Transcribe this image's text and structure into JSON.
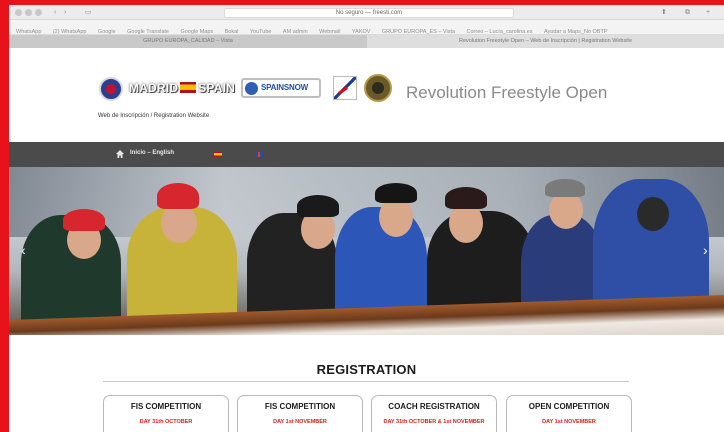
{
  "browser": {
    "address": "No seguro — freesti.com",
    "bookmarks": [
      "WhatsApp",
      "(2) WhatsApp",
      "Google",
      "Google Translate",
      "Google Maps",
      "Bokal",
      "YouTube",
      "AM admin",
      "Webmail",
      "YAKOV",
      "GRUPO EUROPA_ES – Vista",
      "Correo – Lucía_carolina.es",
      "Ayudar a Maps_No OBTP"
    ],
    "tabs": [
      "GRUPO EUROPA_CALIDAD – Vista",
      "Revolution Freestyle Open – Web de Inscripción | Registration Website"
    ]
  },
  "header": {
    "logo_madrid_left": "MADRID",
    "logo_madrid_right": "SPAIN",
    "logo_snow": "SPAINSNOW",
    "site_title": "Revolution Freestyle Open",
    "subtitle": "Web de Inscripción / Registration Website"
  },
  "nav": {
    "home_label": "Inicio – English"
  },
  "registration": {
    "title": "REGISTRATION",
    "cards": [
      {
        "title": "FIS COMPETITION",
        "date": "DAY 31th OCTOBER"
      },
      {
        "title": "FIS COMPETITION",
        "date": "DAY 1st NOVEMBER"
      },
      {
        "title": "COACH REGISTRATION",
        "date": "DAY 31th OCTOBER & 1st NOVEMBER"
      },
      {
        "title": "OPEN COMPETITION",
        "date": "DAY 1st NOVEMBER"
      }
    ]
  },
  "colors": {
    "frame_red": "#e8131a",
    "nav_bg": "#4b4b4b",
    "date_red": "#d21f1f"
  },
  "icons": {
    "home": "home-icon",
    "prev": "chevron-left-icon",
    "next": "chevron-right-icon"
  }
}
